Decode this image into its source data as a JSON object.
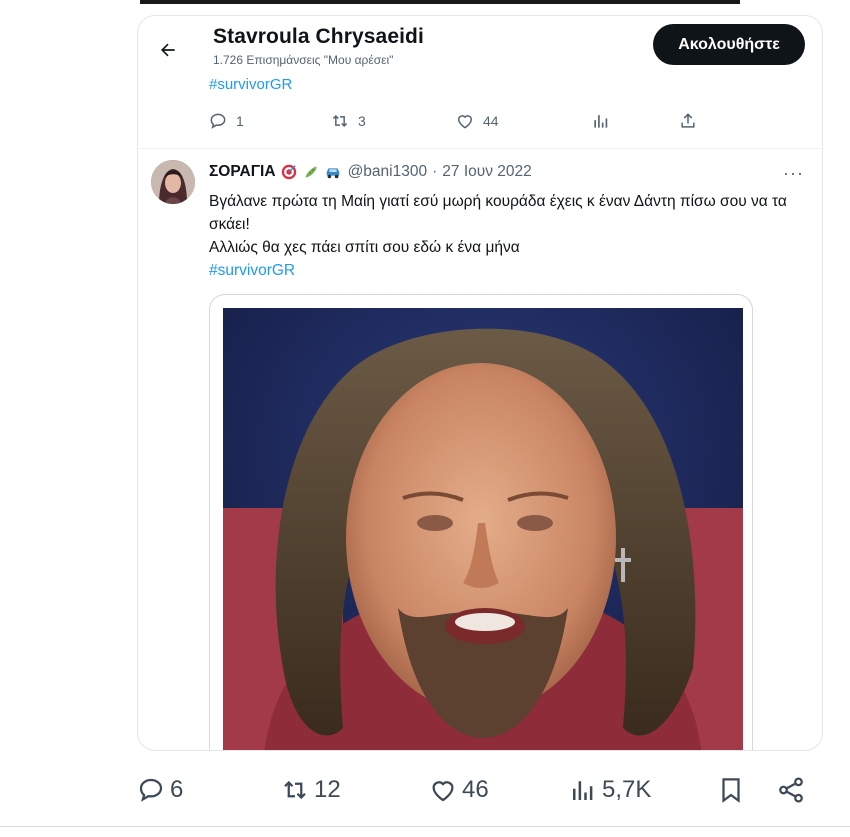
{
  "profile": {
    "name": "Stavroula Chrysaeidi",
    "likes_count": "1.726 Επισημάνσεις \"Μου αρέσει\"",
    "hashtag": "#survivorGR",
    "follow_label": "Ακολουθήστε"
  },
  "quote_actions": {
    "replies": "1",
    "reposts": "3",
    "likes": "44"
  },
  "quoted_tweet": {
    "author_name": "ΣΟΡΑΓΙΑ",
    "emojis": [
      "target-emoji",
      "cucumber-emoji",
      "car-emoji"
    ],
    "handle": "@bani1300",
    "separator": "·",
    "date": "27 Ιουν 2022",
    "more": "···",
    "text_line_1": "Βγάλανε πρώτα τη Μαίη γιατί εσύ μωρή κουράδα έχεις κ έναν Δάντη πίσω σου να τα σκάει!",
    "text_line_2": "Αλλιώς θα χες πάει σπίτι σου εδώ κ ένα μήνα",
    "hashtag": "#survivorGR"
  },
  "tweet_actions": {
    "replies": "6",
    "reposts": "12",
    "likes": "46",
    "views": "5,7K"
  },
  "colors": {
    "accent": "#1d9bf0",
    "text": "#0f1419",
    "muted": "#536471",
    "button_bg": "#0f1419"
  }
}
